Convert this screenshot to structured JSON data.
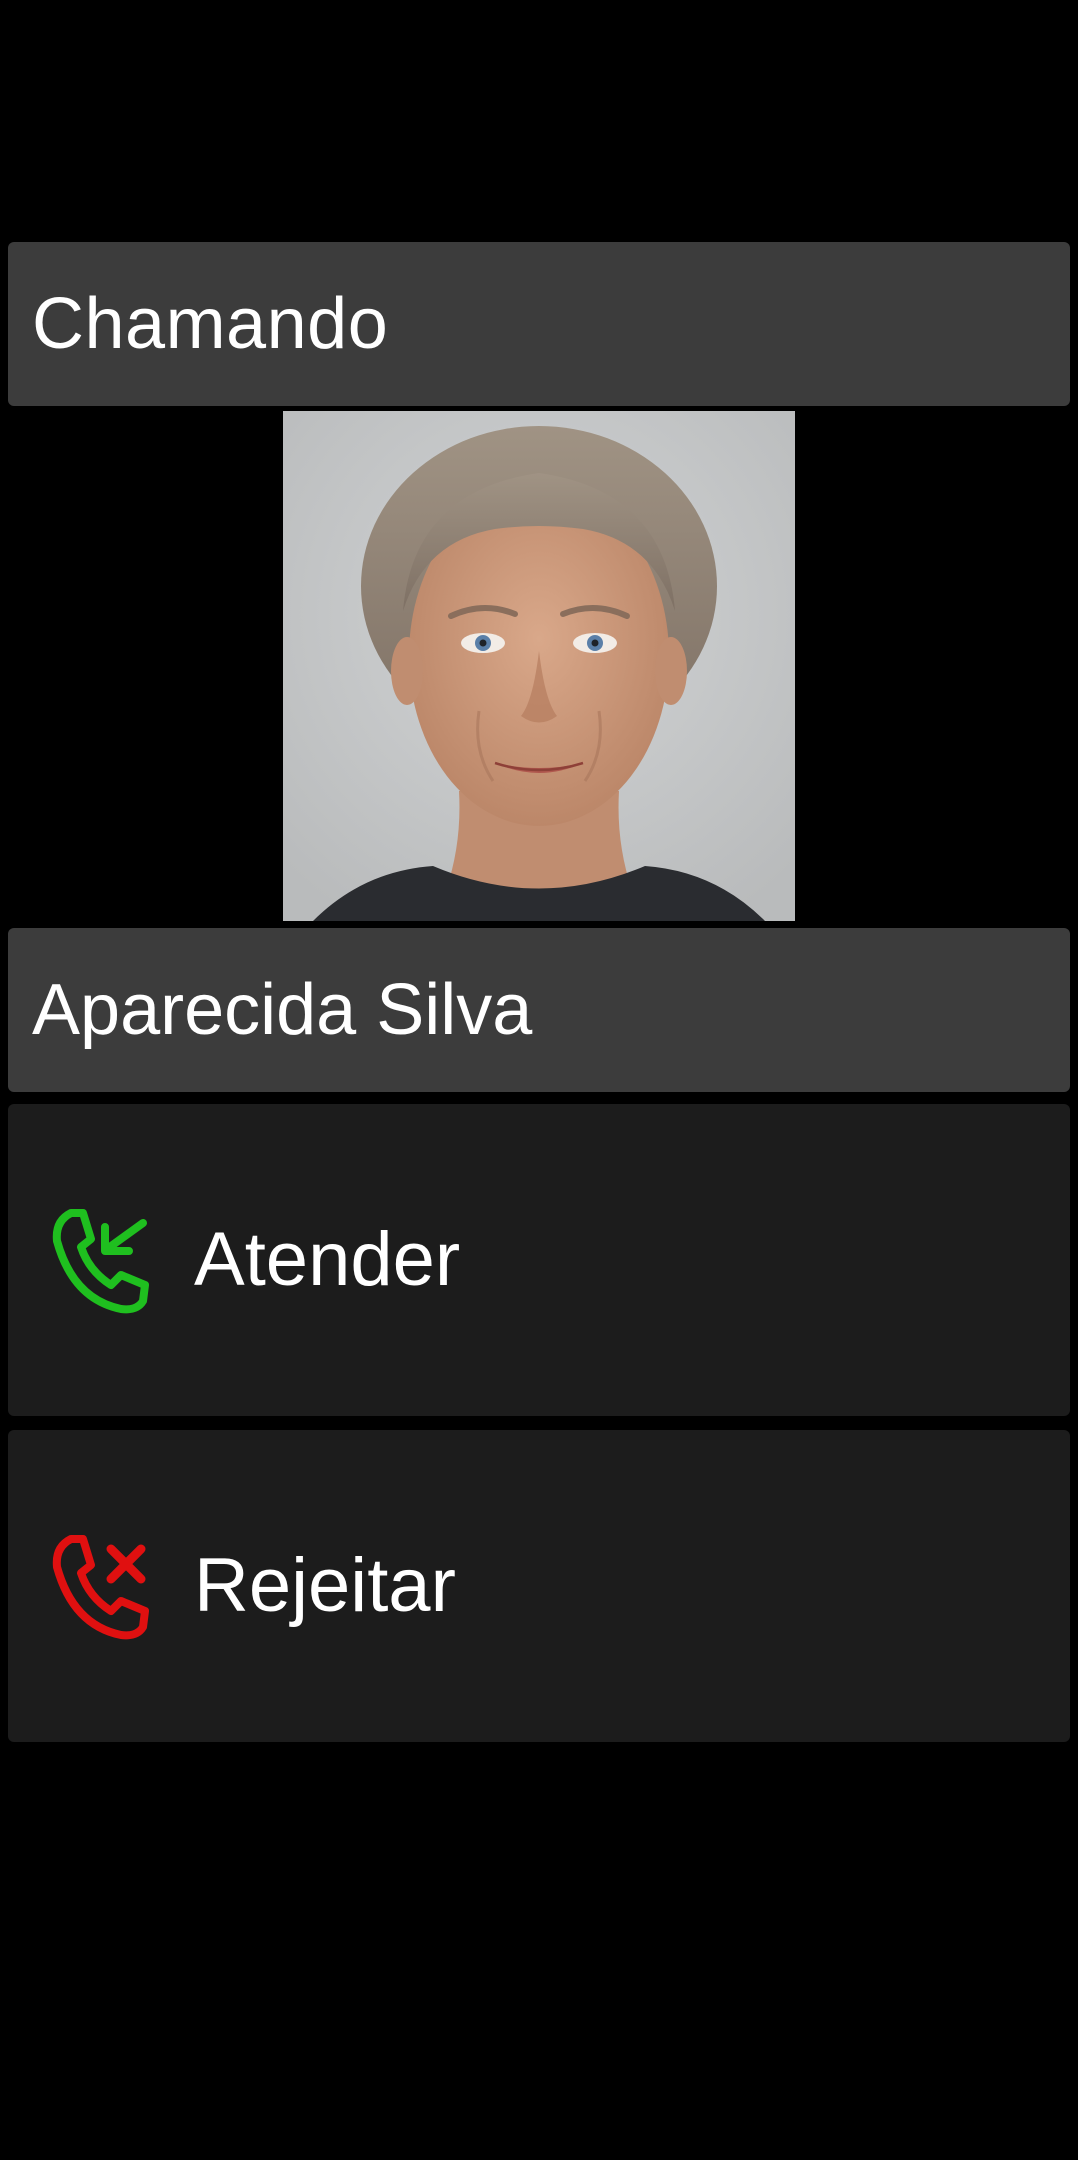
{
  "call": {
    "status_label": "Chamando",
    "caller_name": "Aparecida Silva"
  },
  "actions": {
    "answer": {
      "label": "Atender",
      "icon": "phone-incoming-icon",
      "color": "#1fbf1f"
    },
    "reject": {
      "label": "Rejeitar",
      "icon": "phone-reject-icon",
      "color": "#e01010"
    }
  },
  "colors": {
    "background": "#000000",
    "header_box": "#3c3c3c",
    "button_box": "#1c1c1c",
    "text": "#ffffff"
  }
}
